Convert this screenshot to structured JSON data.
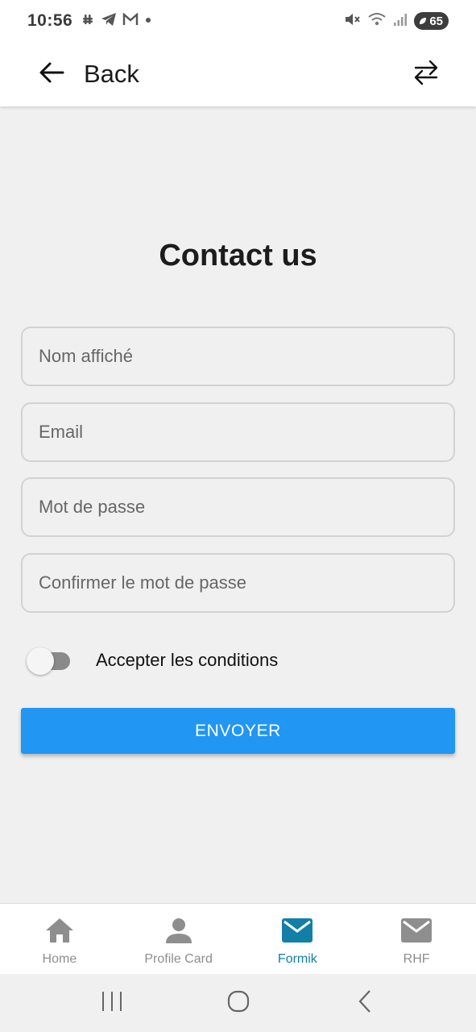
{
  "status_bar": {
    "time": "10:56",
    "battery": "65"
  },
  "app_bar": {
    "back_label": "Back"
  },
  "form": {
    "title": "Contact us",
    "fields": [
      {
        "placeholder": "Nom affiché",
        "value": ""
      },
      {
        "placeholder": "Email",
        "value": ""
      },
      {
        "placeholder": "Mot de passe",
        "value": ""
      },
      {
        "placeholder": "Confirmer le mot de passe",
        "value": ""
      }
    ],
    "terms_label": "Accepter les conditions",
    "terms_checked": false,
    "submit_label": "ENVOYER"
  },
  "tabs": [
    {
      "label": "Home",
      "icon": "home-icon",
      "active": false
    },
    {
      "label": "Profile Card",
      "icon": "person-icon",
      "active": false
    },
    {
      "label": "Formik",
      "icon": "mail-icon",
      "active": true
    },
    {
      "label": "RHF",
      "icon": "mail-icon",
      "active": false
    }
  ],
  "colors": {
    "primary_button": "#2196f3",
    "active_tab": "#127fa8",
    "inactive_tab": "#8e8e8e",
    "background": "#f0f0f0"
  }
}
